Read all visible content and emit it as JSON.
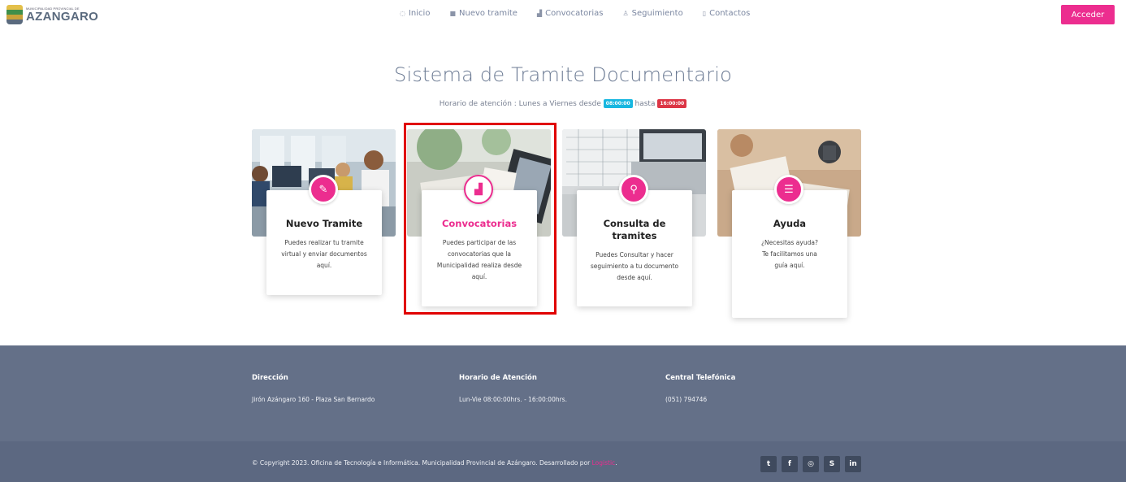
{
  "header": {
    "logo_small": "MUNICIPALIDAD PROVINCIAL DE",
    "logo_big": "AZANGARO",
    "nav": [
      {
        "label": "Inicio",
        "icon": "power-icon"
      },
      {
        "label": "Nuevo tramite",
        "icon": "document-icon"
      },
      {
        "label": "Convocatorias",
        "icon": "bar-chart-icon"
      },
      {
        "label": "Seguimiento",
        "icon": "user-icon"
      },
      {
        "label": "Contactos",
        "icon": "phone-icon"
      }
    ],
    "login_label": "Acceder"
  },
  "main": {
    "title": "Sistema de Tramite Documentario",
    "schedule_prefix": "Horario de atención : Lunes a Viernes desde",
    "schedule_start": "08:00:00",
    "schedule_middle": "hasta",
    "schedule_end": "16:00:00"
  },
  "cards": [
    {
      "title": "Nuevo Tramite",
      "desc": "Puedes realizar tu tramite virtual y enviar documentos aquí.",
      "icon": "edit-icon"
    },
    {
      "title": "Convocatorias",
      "desc": "Puedes participar de las convocatorias que la Municipalidad realiza desde aquí.",
      "icon": "bar-chart-icon"
    },
    {
      "title": "Consulta de tramites",
      "desc": "Puedes Consultar y hacer seguimiento a tu documento desde aquí.",
      "icon": "search-icon"
    },
    {
      "title": "Ayuda",
      "desc": "¿Necesitas ayuda? Te facilitamos una guía aquí.",
      "icon": "chat-icon"
    }
  ],
  "footer": {
    "address_label": "Dirección",
    "address_value": "Jirón Azángaro 160 - Plaza San Bernardo",
    "hours_label": "Horario de Atención",
    "hours_value": "Lun-Vie 08:00:00hrs. - 16:00:00hrs.",
    "phone_label": "Central Telefónica",
    "phone_value": "(051) 794746",
    "copyright": "© Copyright 2023. Oficina de Tecnología e Informática. Municipalidad Provincial de Azángaro. Desarrollado por",
    "developer": "Logistic",
    "socials": [
      "twitter-icon",
      "facebook-icon",
      "instagram-icon",
      "skype-icon",
      "linkedin-icon"
    ]
  },
  "colors": {
    "accent": "#ec2d8f",
    "footer": "#647088",
    "badge_start": "#18b7e0",
    "badge_end": "#dc3545"
  }
}
